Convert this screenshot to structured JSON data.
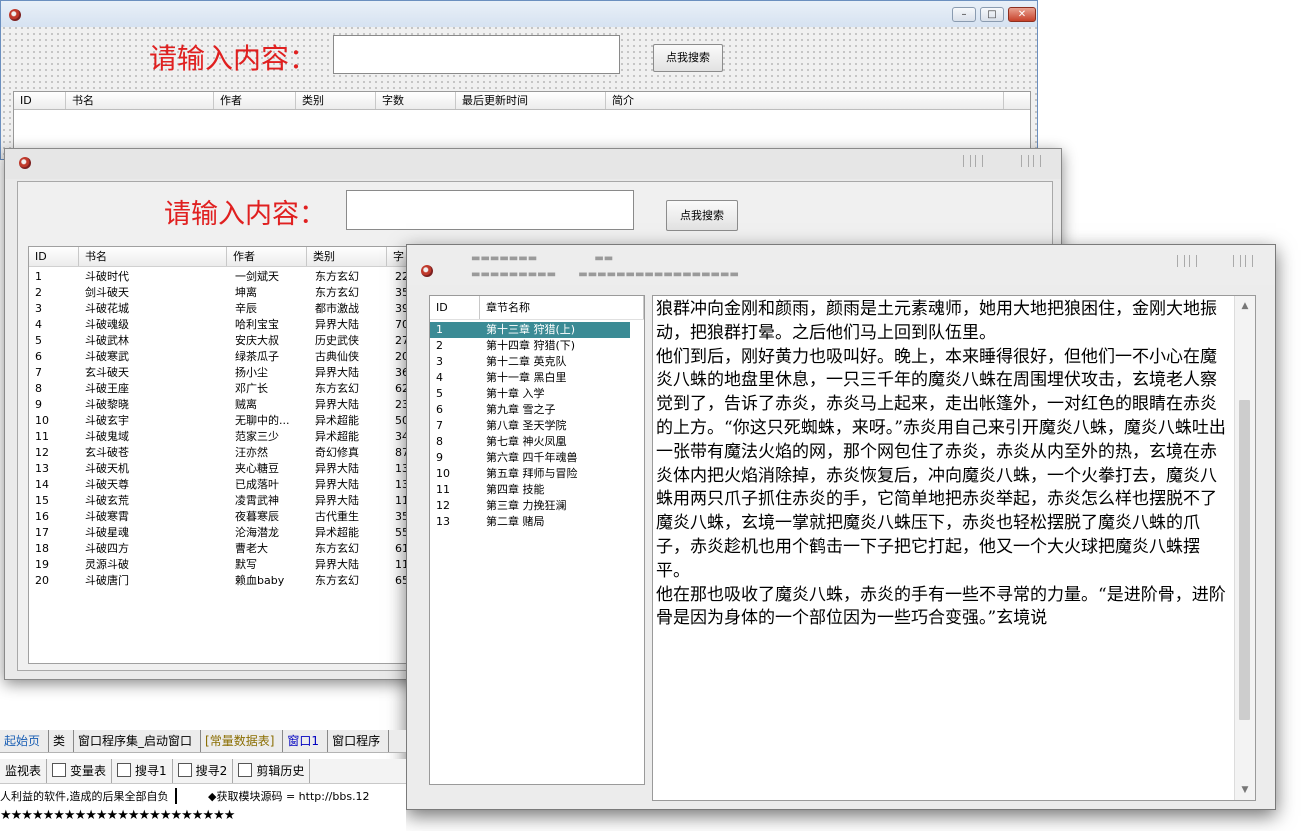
{
  "back_window": {
    "prompt": "请输入内容：",
    "search_button": "点我搜索",
    "columns": [
      "ID",
      "书名",
      "作者",
      "类别",
      "字数",
      "最后更新时间",
      "简介"
    ]
  },
  "list_window": {
    "prompt": "请输入内容：",
    "search_button": "点我搜索",
    "columns": [
      "ID",
      "书名",
      "作者",
      "类别",
      "字"
    ],
    "rows": [
      {
        "id": "1",
        "name": "斗破时代",
        "author": "一剑斌天",
        "cat": "东方玄幻",
        "words": "22"
      },
      {
        "id": "2",
        "name": "剑斗破天",
        "author": "坤离",
        "cat": "东方玄幻",
        "words": "35"
      },
      {
        "id": "3",
        "name": "斗破花城",
        "author": "辛辰",
        "cat": "都市激战",
        "words": "39"
      },
      {
        "id": "4",
        "name": "斗破魂级",
        "author": "哈利宝宝",
        "cat": "异界大陆",
        "words": "70"
      },
      {
        "id": "5",
        "name": "斗破武林",
        "author": "安庆大叔",
        "cat": "历史武侠",
        "words": "27"
      },
      {
        "id": "6",
        "name": "斗破寒武",
        "author": "绿茶瓜子",
        "cat": "古典仙侠",
        "words": "20"
      },
      {
        "id": "7",
        "name": "玄斗破天",
        "author": "扬小尘",
        "cat": "异界大陆",
        "words": "36"
      },
      {
        "id": "8",
        "name": "斗破王座",
        "author": "邓广长",
        "cat": "东方玄幻",
        "words": "62"
      },
      {
        "id": "9",
        "name": "斗破黎晓",
        "author": "贼离",
        "cat": "异界大陆",
        "words": "23"
      },
      {
        "id": "10",
        "name": "斗破玄宇",
        "author": "无聊中的...",
        "cat": "异术超能",
        "words": "50"
      },
      {
        "id": "11",
        "name": "斗破鬼域",
        "author": "范家三少",
        "cat": "异术超能",
        "words": "34"
      },
      {
        "id": "12",
        "name": "玄斗破苍",
        "author": "汪亦然",
        "cat": "奇幻修真",
        "words": "87"
      },
      {
        "id": "13",
        "name": "斗破天机",
        "author": "夹心糖豆",
        "cat": "异界大陆",
        "words": "13"
      },
      {
        "id": "14",
        "name": "斗破天尊",
        "author": "已成落叶",
        "cat": "异界大陆",
        "words": "13"
      },
      {
        "id": "15",
        "name": "斗破玄荒",
        "author": "凌霄武神",
        "cat": "异界大陆",
        "words": "11"
      },
      {
        "id": "16",
        "name": "斗破寒霄",
        "author": "夜暮寒辰",
        "cat": "古代重生",
        "words": "35"
      },
      {
        "id": "17",
        "name": "斗破星魂",
        "author": "沦海潜龙",
        "cat": "异术超能",
        "words": "55"
      },
      {
        "id": "18",
        "name": "斗破四方",
        "author": "曹老大",
        "cat": "东方玄幻",
        "words": "61"
      },
      {
        "id": "19",
        "name": "灵源斗破",
        "author": "默写",
        "cat": "异界大陆",
        "words": "11"
      },
      {
        "id": "20",
        "name": "斗破唐门",
        "author": "赖血baby",
        "cat": "东方玄幻",
        "words": "65"
      }
    ]
  },
  "reader_window": {
    "columns": [
      "ID",
      "章节名称"
    ],
    "chapters": [
      {
        "id": "1",
        "name": "第十三章 狩猎(上)"
      },
      {
        "id": "2",
        "name": "第十四章 狩猎(下)"
      },
      {
        "id": "3",
        "name": "第十二章 英克队"
      },
      {
        "id": "4",
        "name": "第十一章 黑白里"
      },
      {
        "id": "5",
        "name": "第十章 入学"
      },
      {
        "id": "6",
        "name": "第九章 雪之子"
      },
      {
        "id": "7",
        "name": "第八章 圣天学院"
      },
      {
        "id": "8",
        "name": "第七章 神火凤凰"
      },
      {
        "id": "9",
        "name": "第六章 四千年魂兽"
      },
      {
        "id": "10",
        "name": "第五章 拜师与冒险"
      },
      {
        "id": "11",
        "name": "第四章 技能"
      },
      {
        "id": "12",
        "name": "第三章 力挽狂澜"
      },
      {
        "id": "13",
        "name": "第二章 赌局"
      }
    ],
    "selected_index": 0,
    "content": "狼群冲向金刚和颜雨，颜雨是土元素魂师，她用大地把狼困住，金刚大地振动，把狼群打晕。之后他们马上回到队伍里。\n他们到后，刚好黄力也吸叫好。晚上，本来睡得很好，但他们一不小心在魔炎八蛛的地盘里休息，一只三千年的魔炎八蛛在周围埋伏攻击，玄境老人察觉到了，告诉了赤炎，赤炎马上起来，走出帐篷外，一对红色的眼睛在赤炎的上方。“你这只死蜘蛛，来呀。”赤炎用自己来引开魔炎八蛛，魔炎八蛛吐出一张带有魔法火焰的网，那个网包住了赤炎，赤炎从内至外的热，玄境在赤炎体内把火焰消除掉，赤炎恢复后，冲向魔炎八蛛，一个火拳打去，魔炎八蛛用两只爪子抓住赤炎的手，它简单地把赤炎举起，赤炎怎么样也摆脱不了魔炎八蛛，玄境一掌就把魔炎八蛛压下，赤炎也轻松摆脱了魔炎八蛛的爪子，赤炎趁机也用个鹤击一下子把它打起，他又一个大火球把魔炎八蛛摆平。\n他在那也吸收了魔炎八蛛，赤炎的手有一些不寻常的力量。“是进阶骨，进阶骨是因为身体的一个部位因为一些巧合变强。”玄境说"
  },
  "ide": {
    "tabs": [
      "起始页",
      "类",
      "窗口程序集_启动窗口",
      "[常量数据表]",
      "窗口1",
      "窗口程序"
    ],
    "tools": [
      "监视表",
      "变量表",
      "搜寻1",
      "搜寻2",
      "剪辑历史"
    ],
    "log_line1_left": "人利益的软件,造成的后果全部自负",
    "log_line1_right": "◆获取模块源码   =  http://bbs.12",
    "log_line2": "★★★★★★★★★★★★★★★★★★★★★★"
  }
}
